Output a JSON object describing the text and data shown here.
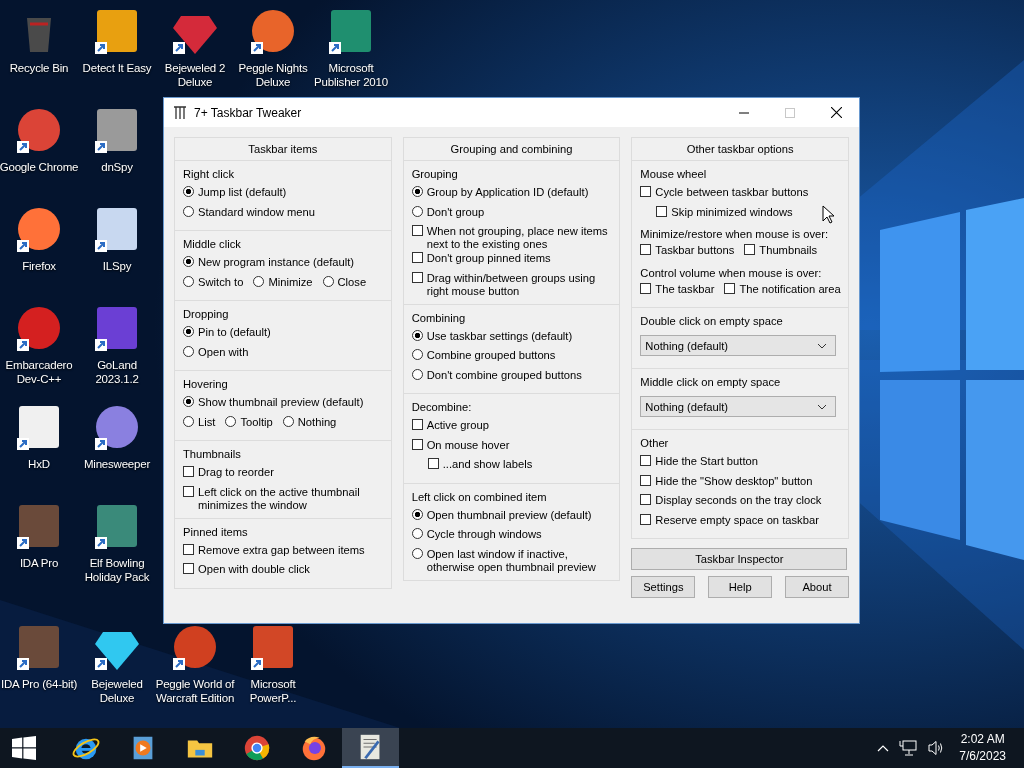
{
  "desktop": {
    "rows": [
      [
        {
          "label": "Recycle Bin",
          "kind": "bin",
          "color": "#4a4a4a",
          "shortcut": false
        },
        {
          "label": "Detect It Easy",
          "kind": "square",
          "color": "#e8a010",
          "shortcut": true
        },
        {
          "label": "Bejeweled 2 Deluxe",
          "kind": "gem",
          "color": "#d42a3a",
          "shortcut": true
        },
        {
          "label": "Peggle Nights Deluxe",
          "kind": "circle",
          "color": "#e8642a",
          "shortcut": true
        },
        {
          "label": "Microsoft Publisher 2010",
          "kind": "square",
          "color": "#1f8f6f",
          "shortcut": true
        }
      ],
      [
        {
          "label": "Google Chrome",
          "kind": "circle",
          "color": "#db4437",
          "shortcut": true
        },
        {
          "label": "dnSpy",
          "kind": "square",
          "color": "#9a9a9a",
          "shortcut": true
        }
      ],
      [
        {
          "label": "Firefox",
          "kind": "circle",
          "color": "#ff7139",
          "shortcut": true
        },
        {
          "label": "ILSpy",
          "kind": "square",
          "color": "#c8d8f0",
          "shortcut": true
        }
      ],
      [
        {
          "label": "Embarcadero Dev-C++",
          "kind": "circle",
          "color": "#d42020",
          "shortcut": true
        },
        {
          "label": "GoLand 2023.1.2",
          "kind": "square",
          "color": "#6b3fd4",
          "shortcut": true
        }
      ],
      [
        {
          "label": "HxD",
          "kind": "square",
          "color": "#f0f0f0",
          "shortcut": true
        },
        {
          "label": "Minesweeper",
          "kind": "circle",
          "color": "#8a80e0",
          "shortcut": true
        }
      ],
      [
        {
          "label": "IDA Pro",
          "kind": "square",
          "color": "#6a4a3a",
          "shortcut": true
        },
        {
          "label": "Elf Bowling Holiday Pack",
          "kind": "square",
          "color": "#3a8a7a",
          "shortcut": true
        }
      ],
      [
        {
          "label": "IDA Pro (64-bit)",
          "kind": "square",
          "color": "#6a4a3a",
          "shortcut": true
        },
        {
          "label": "Bejeweled Deluxe",
          "kind": "gem",
          "color": "#30c8f0",
          "shortcut": true
        },
        {
          "label": "Peggle World of Warcraft Edition",
          "kind": "circle",
          "color": "#d04020",
          "shortcut": true
        },
        {
          "label": "Microsoft PowerP...",
          "kind": "square",
          "color": "#d24726",
          "shortcut": true
        }
      ]
    ]
  },
  "window": {
    "title": "7+ Taskbar Tweaker",
    "maximize_enabled": false,
    "columns": [
      {
        "title": "Taskbar items",
        "sections": [
          {
            "title": "Right click",
            "items": [
              {
                "kind": "radio",
                "label": "Jump list (default)",
                "selected": true
              },
              {
                "kind": "radio",
                "label": "Standard window menu",
                "selected": false
              }
            ]
          },
          {
            "title": "Middle click",
            "items": [
              {
                "kind": "radio",
                "label": "New program instance (default)",
                "selected": true
              },
              {
                "kind": "row",
                "items": [
                  {
                    "kind": "radio",
                    "label": "Switch to",
                    "selected": false
                  },
                  {
                    "kind": "radio",
                    "label": "Minimize",
                    "selected": false
                  },
                  {
                    "kind": "radio",
                    "label": "Close",
                    "selected": false
                  }
                ]
              }
            ]
          },
          {
            "title": "Dropping",
            "items": [
              {
                "kind": "radio",
                "label": "Pin to (default)",
                "selected": true
              },
              {
                "kind": "radio",
                "label": "Open with",
                "selected": false
              }
            ]
          },
          {
            "title": "Hovering",
            "items": [
              {
                "kind": "radio",
                "label": "Show thumbnail preview (default)",
                "selected": true
              },
              {
                "kind": "row",
                "items": [
                  {
                    "kind": "radio",
                    "label": "List",
                    "selected": false
                  },
                  {
                    "kind": "radio",
                    "label": "Tooltip",
                    "selected": false
                  },
                  {
                    "kind": "radio",
                    "label": "Nothing",
                    "selected": false
                  }
                ]
              }
            ]
          },
          {
            "title": "Thumbnails",
            "items": [
              {
                "kind": "check",
                "label": "Drag to reorder",
                "checked": false
              },
              {
                "kind": "check",
                "label": "Left click on the active thumbnail minimizes the window",
                "checked": false
              }
            ]
          },
          {
            "title": "Pinned items",
            "items": [
              {
                "kind": "check",
                "label": "Remove extra gap between items",
                "checked": false
              },
              {
                "kind": "check",
                "label": "Open with double click",
                "checked": false
              }
            ]
          }
        ]
      },
      {
        "title": "Grouping and combining",
        "sections": [
          {
            "title": "Grouping",
            "items": [
              {
                "kind": "radio",
                "label": "Group by Application ID (default)",
                "selected": true
              },
              {
                "kind": "radio",
                "label": "Don't group",
                "selected": false
              },
              {
                "kind": "check",
                "label": "When not grouping, place new items next to the existing ones",
                "checked": false
              },
              {
                "kind": "check",
                "label": "Don't group pinned items",
                "checked": false
              },
              {
                "kind": "check",
                "label": "Drag within/between groups using right mouse button",
                "checked": false
              }
            ]
          },
          {
            "title": "Combining",
            "items": [
              {
                "kind": "radio",
                "label": "Use taskbar settings (default)",
                "selected": true
              },
              {
                "kind": "radio",
                "label": "Combine grouped buttons",
                "selected": false
              },
              {
                "kind": "radio",
                "label": "Don't combine grouped buttons",
                "selected": false
              }
            ]
          },
          {
            "title": "Decombine:",
            "items": [
              {
                "kind": "check",
                "label": "Active group",
                "checked": false
              },
              {
                "kind": "check",
                "label": "On mouse hover",
                "checked": false,
                "children": [
                  {
                    "kind": "check",
                    "label": "...and show labels",
                    "checked": false
                  }
                ]
              }
            ]
          },
          {
            "title": "Left click on combined item",
            "items": [
              {
                "kind": "radio",
                "label": "Open thumbnail preview (default)",
                "selected": true
              },
              {
                "kind": "radio",
                "label": "Cycle through windows",
                "selected": false
              },
              {
                "kind": "radio",
                "label": "Open last window if inactive, otherwise open thumbnail preview",
                "selected": false
              }
            ]
          }
        ]
      },
      {
        "title": "Other taskbar options",
        "sections": [
          {
            "title": "Mouse wheel",
            "items": [
              {
                "kind": "check",
                "label": "Cycle between taskbar buttons",
                "checked": false,
                "children": [
                  {
                    "kind": "check",
                    "label": "Skip minimized windows",
                    "checked": false
                  }
                ]
              },
              {
                "kind": "label",
                "label": "Minimize/restore when mouse is over:"
              },
              {
                "kind": "row",
                "items": [
                  {
                    "kind": "check",
                    "label": "Taskbar buttons",
                    "checked": false
                  },
                  {
                    "kind": "check",
                    "label": "Thumbnails",
                    "checked": false
                  }
                ]
              },
              {
                "kind": "label",
                "label": "Control volume when mouse is over:"
              },
              {
                "kind": "row",
                "items": [
                  {
                    "kind": "check",
                    "label": "The taskbar",
                    "checked": false
                  },
                  {
                    "kind": "check",
                    "label": "The notification area",
                    "checked": false
                  }
                ]
              }
            ]
          },
          {
            "title": "Double click on empty space",
            "items": [
              {
                "kind": "select",
                "value": "Nothing (default)"
              }
            ]
          },
          {
            "title": "Middle click on empty space",
            "items": [
              {
                "kind": "select",
                "value": "Nothing (default)"
              }
            ]
          },
          {
            "title": "Other",
            "items": [
              {
                "kind": "check",
                "label": "Hide the Start button",
                "checked": false
              },
              {
                "kind": "check",
                "label": "Hide the \"Show desktop\" button",
                "checked": false
              },
              {
                "kind": "check",
                "label": "Display seconds on the tray clock",
                "checked": false
              },
              {
                "kind": "check",
                "label": "Reserve empty space on taskbar",
                "checked": false
              }
            ]
          }
        ],
        "buttons": [
          {
            "label": "Taskbar Inspector",
            "kind": "wide"
          },
          {
            "label": "Settings",
            "kind": "normal"
          },
          {
            "label": "Help",
            "kind": "normal"
          },
          {
            "label": "About",
            "kind": "normal"
          }
        ]
      }
    ]
  },
  "taskbar": {
    "apps": [
      {
        "kind": "ie",
        "selected": false
      },
      {
        "kind": "media",
        "selected": false
      },
      {
        "kind": "folder",
        "selected": false
      },
      {
        "kind": "chrome",
        "selected": false
      },
      {
        "kind": "firefox",
        "selected": false
      },
      {
        "kind": "tweaker",
        "selected": true
      }
    ],
    "clock_time": "2:02 AM",
    "clock_date": "7/6/2023"
  }
}
